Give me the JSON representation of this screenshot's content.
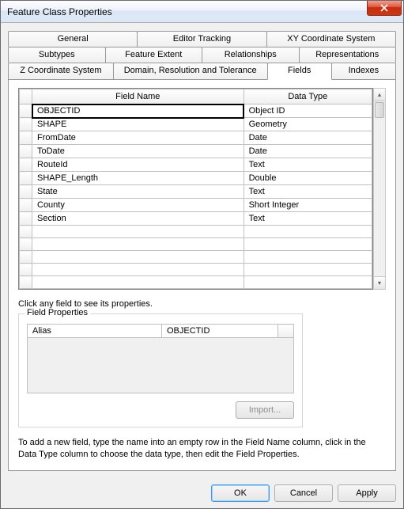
{
  "window": {
    "title": "Feature Class Properties"
  },
  "tabs": {
    "row1": [
      "General",
      "Editor Tracking",
      "XY Coordinate System"
    ],
    "row2": [
      "Subtypes",
      "Feature Extent",
      "Relationships",
      "Representations"
    ],
    "row3": [
      "Z Coordinate System",
      "Domain, Resolution and Tolerance",
      "Fields",
      "Indexes"
    ],
    "active": "Fields"
  },
  "grid": {
    "headers": {
      "field_name": "Field Name",
      "data_type": "Data Type"
    },
    "rows": [
      {
        "name": "OBJECTID",
        "type": "Object ID"
      },
      {
        "name": "SHAPE",
        "type": "Geometry"
      },
      {
        "name": "FromDate",
        "type": "Date"
      },
      {
        "name": "ToDate",
        "type": "Date"
      },
      {
        "name": "RouteId",
        "type": "Text"
      },
      {
        "name": "SHAPE_Length",
        "type": "Double"
      },
      {
        "name": "State",
        "type": "Text"
      },
      {
        "name": "County",
        "type": "Short Integer"
      },
      {
        "name": "Section",
        "type": "Text"
      }
    ],
    "empty_rows": 5
  },
  "hints": {
    "click_field": "Click any field to see its properties.",
    "add_field": "To add a new field, type the name into an empty row in the Field Name column, click in the Data Type column to choose the data type, then edit the Field Properties."
  },
  "field_properties": {
    "legend": "Field Properties",
    "rows": [
      {
        "key": "Alias",
        "value": "OBJECTID"
      }
    ]
  },
  "buttons": {
    "import": "Import...",
    "ok": "OK",
    "cancel": "Cancel",
    "apply": "Apply"
  }
}
